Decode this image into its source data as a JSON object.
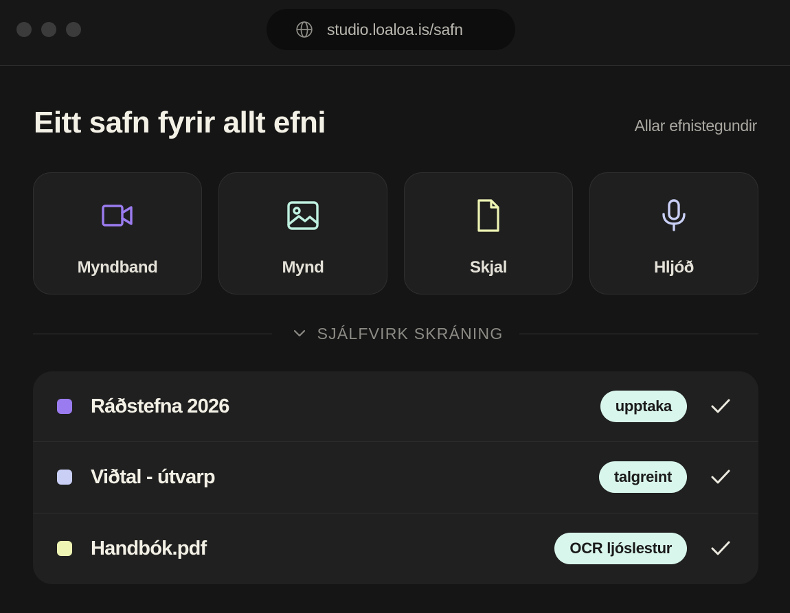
{
  "window": {
    "url": "studio.loaloa.is/safn"
  },
  "header": {
    "title": "Eitt safn fyrir allt efni",
    "all_types_link": "Allar efnistegundir"
  },
  "content_types": [
    {
      "label": "Myndband",
      "icon": "video-icon",
      "color": "#9b7cf0"
    },
    {
      "label": "Mynd",
      "icon": "image-icon",
      "color": "#bff0e0"
    },
    {
      "label": "Skjal",
      "icon": "document-icon",
      "color": "#eef4b4"
    },
    {
      "label": "Hljóð",
      "icon": "microphone-icon",
      "color": "#c9cff5"
    }
  ],
  "section": {
    "toggle_label": "SJÁLFVIRK SKRÁNING"
  },
  "items": [
    {
      "title": "Ráðstefna 2026",
      "tag": "upptaka",
      "swatch_color": "#9b7cf0"
    },
    {
      "title": "Viðtal - útvarp",
      "tag": "talgreint",
      "swatch_color": "#c9cff5"
    },
    {
      "title": "Handbók.pdf",
      "tag": "OCR ljóslestur",
      "swatch_color": "#eef4b4"
    }
  ]
}
